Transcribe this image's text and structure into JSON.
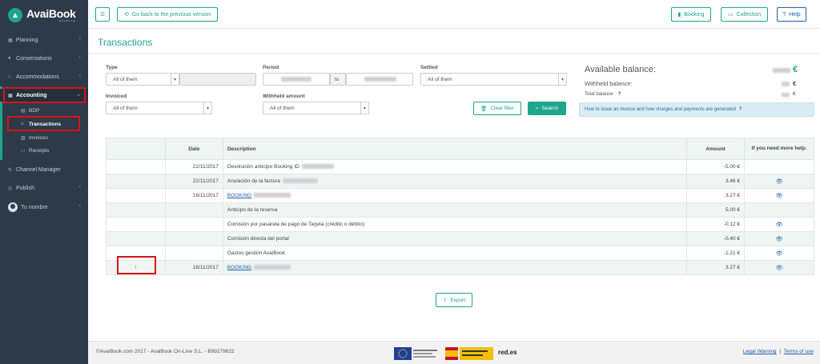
{
  "app": {
    "brand": "AvaiBook",
    "brand_sub": "booking"
  },
  "sidebar": {
    "items": [
      {
        "label": "Planning"
      },
      {
        "label": "Conversations"
      },
      {
        "label": "Accommodations"
      },
      {
        "label": "Accounting"
      },
      {
        "label": "BDP"
      },
      {
        "label": "Transactions"
      },
      {
        "label": "Invoices"
      },
      {
        "label": "Receipts"
      },
      {
        "label": "Channel Manager"
      },
      {
        "label": "Publish"
      },
      {
        "label": "Tu nombre"
      }
    ]
  },
  "topbar": {
    "back_label": "Go back to the previous version",
    "booking_label": "Booking",
    "collection_label": "Collection",
    "help_label": "Help"
  },
  "page": {
    "title": "Transactions"
  },
  "filters": {
    "type_label": "Type",
    "type_value": "All of them",
    "period_label": "Period",
    "period_to": "to",
    "settled_label": "Settled",
    "settled_value": "All of them",
    "invoiced_label": "Invoiced",
    "invoiced_value": "All of them",
    "withheld_label": "Withheld amount",
    "withheld_value": "All of them",
    "clear_label": "Clear filter",
    "search_label": "Search"
  },
  "balance": {
    "available_label": "Available balance:",
    "withheld_label": "Withheld balance:",
    "total_label": "Total balance:",
    "currency": "€"
  },
  "info": {
    "text": "How to issue an invoice and how charges and payments are generated"
  },
  "table": {
    "headers": {
      "date": "Date",
      "description": "Description",
      "amount": "Amount",
      "help": "If you need more help."
    },
    "rows": [
      {
        "warn": "",
        "date": "22/11/2017",
        "desc": "Devolución anticipo Booking ID",
        "link": false,
        "amount": "-5.00 €",
        "eye": false
      },
      {
        "warn": "",
        "date": "22/11/2017",
        "desc": "Anulación de la factura",
        "link": false,
        "amount": "3.46 €",
        "eye": true
      },
      {
        "warn": "",
        "date": "16/11/2017",
        "desc": "BOOKING",
        "link": true,
        "amount": "3.27 €",
        "eye": true
      },
      {
        "warn": "",
        "date": "",
        "desc": "Anticipo de la reserva",
        "link": false,
        "amount": "5.00 €",
        "eye": false
      },
      {
        "warn": "",
        "date": "",
        "desc": "Comisión por pasarela de pago de Tarjeta (crédito o débito)",
        "link": false,
        "amount": "-0.12 €",
        "eye": true
      },
      {
        "warn": "",
        "date": "",
        "desc": "Comisión directa del portal",
        "link": false,
        "amount": "-0.40 €",
        "eye": true
      },
      {
        "warn": "",
        "date": "",
        "desc": "Gastos gestión AvaiBook",
        "link": false,
        "amount": "-1.21 €",
        "eye": true
      },
      {
        "warn": "!",
        "date": "16/11/2017",
        "desc": "BOOKING",
        "link": true,
        "amount": "3.27 €",
        "eye": true
      }
    ]
  },
  "export_label": "Export",
  "footer": {
    "copyright": "©AvaiBook.com 2017 - AvaiBook On-Line S.L. - B99279622",
    "red_es": "red.es",
    "legal_warning": "Legal Warning",
    "separator": "|",
    "terms": "Terms of use"
  },
  "colors": {
    "accent": "#1fa58e",
    "sidebar": "#2c3b47",
    "link": "#1f5fa8",
    "highlight": "#d9121a",
    "warning": "#f0a500"
  }
}
